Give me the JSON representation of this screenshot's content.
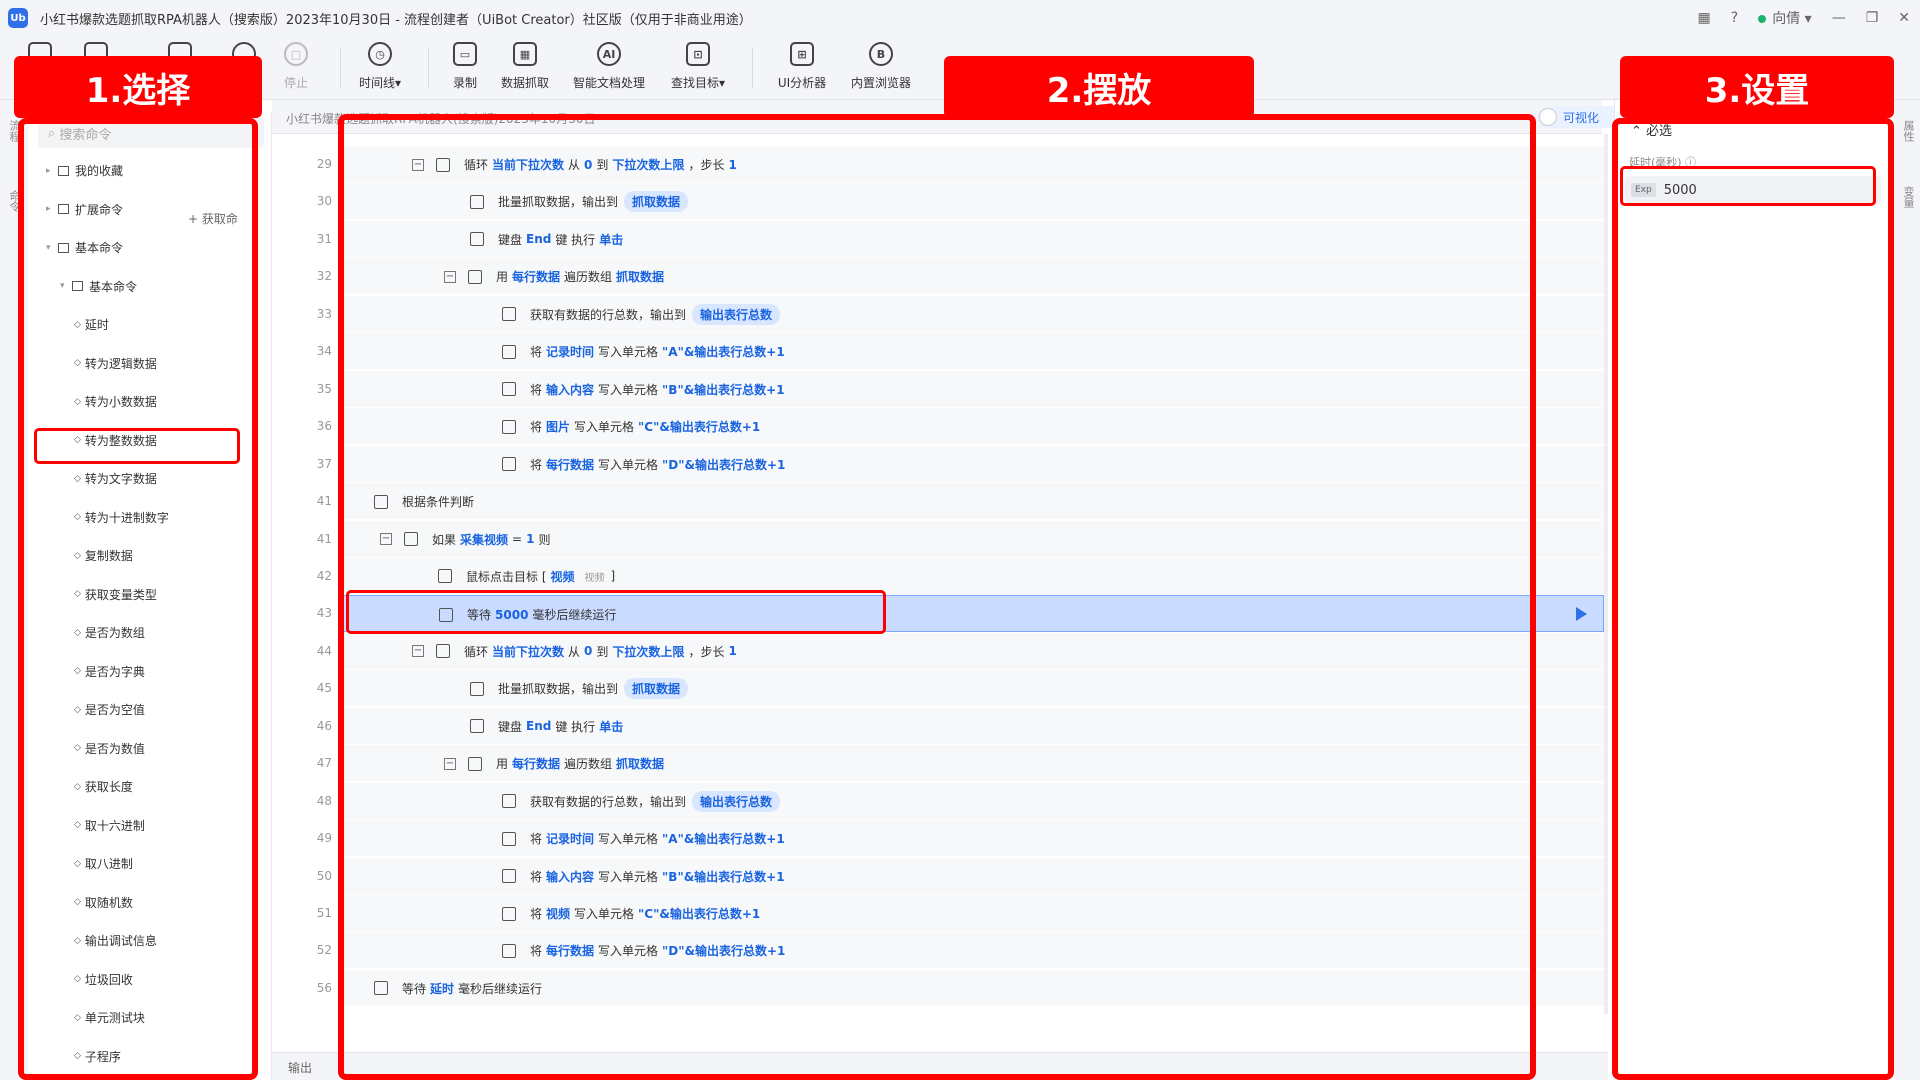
{
  "window": {
    "title": "小红书爆款选题抓取RPA机器人（搜索版）2023年10月30日 - 流程创建者（UiBot Creator）社区版（仅用于非商业用途）",
    "logo": "Ub",
    "user": "向倩",
    "help": "?",
    "apps": "▦",
    "minimize": "—",
    "restore": "❐",
    "close": "✕"
  },
  "toolbar": {
    "stop": "停止",
    "timeline": "时间线▾",
    "record": "录制",
    "data_capture": "数据抓取",
    "smart_doc": "智能文档处理",
    "find_target": "查找目标▾",
    "ui_analyzer": "UI分析器",
    "browser": "内置浏览器",
    "icons": {
      "stop": "□",
      "timeline": "◷",
      "record": "▭",
      "data_capture": "▦",
      "smart_doc": "AI",
      "find_target": "⊡",
      "ui_analyzer": "⊞",
      "browser": "B"
    }
  },
  "left_strip": {
    "tab1": "流程",
    "tab2": "命令"
  },
  "left": {
    "search_placeholder": "搜索命令",
    "add_command": "+ 获取命",
    "tree": [
      {
        "label": "我的收藏",
        "type": "folder"
      },
      {
        "label": "扩展命令",
        "type": "folder"
      },
      {
        "label": "基本命令",
        "type": "folder"
      },
      {
        "label": "基本命令",
        "type": "folder"
      },
      {
        "label": "延时",
        "type": "cmd"
      },
      {
        "label": "转为逻辑数据",
        "type": "cmd"
      },
      {
        "label": "转为小数数据",
        "type": "cmd"
      },
      {
        "label": "转为整数数据",
        "type": "cmd"
      },
      {
        "label": "转为文字数据",
        "type": "cmd"
      },
      {
        "label": "转为十进制数字",
        "type": "cmd"
      },
      {
        "label": "复制数据",
        "type": "cmd"
      },
      {
        "label": "获取变量类型",
        "type": "cmd"
      },
      {
        "label": "是否为数组",
        "type": "cmd"
      },
      {
        "label": "是否为字典",
        "type": "cmd"
      },
      {
        "label": "是否为空值",
        "type": "cmd"
      },
      {
        "label": "是否为数值",
        "type": "cmd"
      },
      {
        "label": "获取长度",
        "type": "cmd"
      },
      {
        "label": "取十六进制",
        "type": "cmd"
      },
      {
        "label": "取八进制",
        "type": "cmd"
      },
      {
        "label": "取随机数",
        "type": "cmd"
      },
      {
        "label": "输出调试信息",
        "type": "cmd"
      },
      {
        "label": "垃圾回收",
        "type": "cmd"
      },
      {
        "label": "单元测试块",
        "type": "cmd"
      },
      {
        "label": "子程序",
        "type": "cmd"
      }
    ]
  },
  "editor": {
    "tab": "小红书爆款选题抓取RPA机器人(搜索版)2023年10月30日",
    "visual_toggle": "可视化",
    "output_label": "输出",
    "rows": [
      {
        "ln": "29",
        "parts": [
          "循环 ",
          "当前下拉次数",
          " 从 ",
          "0",
          " 到 ",
          "下拉次数上限",
          "，步长 ",
          "1"
        ]
      },
      {
        "ln": "30",
        "parts": [
          "批量抓取数据，输出到",
          "抓取数据"
        ]
      },
      {
        "ln": "31",
        "parts": [
          "键盘 ",
          "End",
          " 键 执行 ",
          "单击"
        ]
      },
      {
        "ln": "32",
        "parts": [
          "用 ",
          "每行数据",
          " 遍历数组 ",
          "抓取数据"
        ]
      },
      {
        "ln": "33",
        "parts": [
          "获取有数据的行总数，输出到",
          "输出表行总数"
        ]
      },
      {
        "ln": "34",
        "parts": [
          "将 ",
          "记录时间",
          " 写入单元格 ",
          "\"A\"&输出表行总数+1"
        ]
      },
      {
        "ln": "35",
        "parts": [
          "将 ",
          "输入内容",
          " 写入单元格 ",
          "\"B\"&输出表行总数+1"
        ]
      },
      {
        "ln": "36",
        "parts": [
          "将 ",
          "图片",
          " 写入单元格 ",
          "\"C\"&输出表行总数+1"
        ]
      },
      {
        "ln": "37",
        "parts": [
          "将 ",
          "每行数据",
          " 写入单元格 ",
          "\"D\"&输出表行总数+1"
        ]
      },
      {
        "ln": "41",
        "parts": [
          "根据条件判断"
        ]
      },
      {
        "ln": "41",
        "parts": [
          "如果 ",
          "采集视频",
          " = ",
          "1",
          " 则"
        ]
      },
      {
        "ln": "42",
        "parts": [
          "鼠标点击目标 [ ",
          "视频",
          "视频",
          " ]"
        ]
      },
      {
        "ln": "43",
        "parts": [
          "等待 ",
          "5000",
          " 毫秒后继续运行"
        ]
      },
      {
        "ln": "44",
        "parts": [
          "循环 ",
          "当前下拉次数",
          " 从 ",
          "0",
          " 到 ",
          "下拉次数上限",
          "，步长 ",
          "1"
        ]
      },
      {
        "ln": "45",
        "parts": [
          "批量抓取数据，输出到",
          "抓取数据"
        ]
      },
      {
        "ln": "46",
        "parts": [
          "键盘 ",
          "End",
          " 键 执行 ",
          "单击"
        ]
      },
      {
        "ln": "47",
        "parts": [
          "用 ",
          "每行数据",
          " 遍历数组 ",
          "抓取数据"
        ]
      },
      {
        "ln": "48",
        "parts": [
          "获取有数据的行总数，输出到",
          "输出表行总数"
        ]
      },
      {
        "ln": "49",
        "parts": [
          "将 ",
          "记录时间",
          " 写入单元格 ",
          "\"A\"&输出表行总数+1"
        ]
      },
      {
        "ln": "50",
        "parts": [
          "将 ",
          "输入内容",
          " 写入单元格 ",
          "\"B\"&输出表行总数+1"
        ]
      },
      {
        "ln": "51",
        "parts": [
          "将 ",
          "视频",
          " 写入单元格 ",
          "\"C\"&输出表行总数+1"
        ]
      },
      {
        "ln": "52",
        "parts": [
          "将 ",
          "每行数据",
          " 写入单元格 ",
          "\"D\"&输出表行总数+1"
        ]
      },
      {
        "ln": "56",
        "parts": [
          "等待 ",
          "延时",
          " 毫秒后继续运行"
        ]
      }
    ]
  },
  "properties": {
    "section": "⌃ 必选",
    "field_label": "延时(毫秒) ⓘ",
    "exp_tag": "Exp",
    "field_value": "5000"
  },
  "right_strip": {
    "tab1": "属性",
    "tab2": "变量"
  },
  "annotations": {
    "select": "1.选择",
    "place": "2.摆放",
    "settings": "3.设置",
    "color": "#ff0000"
  }
}
